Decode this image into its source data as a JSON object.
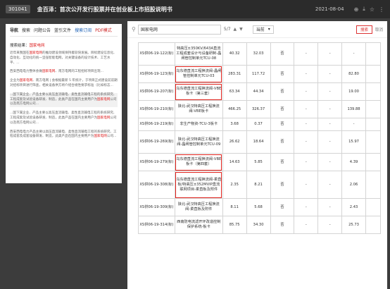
{
  "topbar": {
    "code": "301041",
    "title": "金百泽：首次公开发行股票并在创业板上市招股说明书",
    "date": "2021-08-04",
    "icons": [
      "globe-icon",
      "download-icon",
      "star-icon",
      "more-icon"
    ]
  },
  "left": {
    "tabs": [
      "导航",
      "搜索",
      "问题公告",
      "蓝引文件",
      "搜索订阅",
      "PDF模式"
    ],
    "search_prefix": "搜索结果：",
    "search_keyword": "国家电网",
    "results": [
      {
        "pre": "近年来我国在",
        "kw": "国家电网",
        "post": "的推动建设领域保持着较快发展。目标建设信息化、自动化、互动化的统一坚强智能电网，对关键设备的设计技术、工艺水平、..."
      },
      {
        "pre": "西安西电电力整体会做",
        "kw": "国家电网",
        "post": "、南方电网的工程招标项目出现..."
      },
      {
        "pre": "企业为",
        "kw": "国家电网",
        "post": "、南方电网 | 会根据最新 5 年统计，于项目正式建设前前期对招标项目进行筛查，相关设备供方将介绍合规性要求标准（比如标志..."
      },
      {
        "pre": "...国下属企业、产品主要以高压直流输电、柔性直流输电工程的系统研究、工程成套及试验设备研发、制造，此类产品在国内主要用户为",
        "kw": "国家电网",
        "post": "公司以及南方电网公司..."
      },
      {
        "pre": "...国下属企业、产品主要以高压直流输电、柔性直流输电工程的系统研究、工程成套及试验设备研发、制造，此类产品在国内主要用户为",
        "kw": "国家电网",
        "post": "公司以及南方电网公司..."
      },
      {
        "pre": "西安西电电力产品主要以高压直流输电、柔性直流输电工程的系统研究、工程成套及成套设备研发、制造，此类产品在国内主要用户为",
        "kw": "国家电网",
        "post": "公司..."
      }
    ]
  },
  "main": {
    "search_value": "国家电网",
    "page_current": "5",
    "page_total": "/7",
    "scope": "当前",
    "btn_search": "搜索",
    "btn_cancel": "取消"
  },
  "table_rows": [
    {
      "id": "XS供06-19-122(标)",
      "name": "特高压±350KV/643A直流工程成套设计与设备研制-晶闸管控制单元TCU-08",
      "q": "40.32",
      "a": "32.03",
      "yn": "否",
      "c1": "-",
      "c2": "-",
      "v": "-",
      "rows": 4
    },
    {
      "id": "XS供06-19-123(标)",
      "name": "乌东德直流工程换流阀-晶闸管控制单元TCU-03",
      "q": "283.31",
      "a": "117.72",
      "yn": "否",
      "c1": "-",
      "c2": "-",
      "v": "82.80",
      "rows": 3
    },
    {
      "id": "XS供06-19-207(标)",
      "name": "乌东德直流工程换流阀-VBE板卡（第三套）",
      "q": "63.34",
      "a": "44.34",
      "yn": "否",
      "c1": "-",
      "c2": "-",
      "v": "19.00",
      "rows": 3
    },
    {
      "id": "XS供06-19-210(标)",
      "name": "陕北-武汉特高压工程换流阀-VBE板卡",
      "q": "466.25",
      "a": "326.37",
      "yn": "否",
      "c1": "-",
      "c2": "-",
      "v": "139.88",
      "rows": 3
    },
    {
      "id": "XS供06-19-219(标)",
      "name": "非生产物资-TCU-3板卡",
      "q": "3.68",
      "a": "0.37",
      "yn": "否",
      "c1": "-",
      "c2": "-",
      "v": "-",
      "rows": 2
    },
    {
      "id": "XS供06-19-269(标)",
      "name": "陕北-武汉特高压工程换流阀-晶闸管控制单元TCU-09",
      "q": "26.62",
      "a": "18.64",
      "yn": "否",
      "c1": "-",
      "c2": "-",
      "v": "15.97",
      "rows": 4
    },
    {
      "id": "XS供06-19-279(标)",
      "name": "乌东德直流工程换流阀-VBE板卡（第四套）",
      "q": "14.63",
      "a": "5.85",
      "yn": "否",
      "c1": "-",
      "c2": "-",
      "v": "4.39",
      "rows": 3
    },
    {
      "id": "XS供06-19-308(标)",
      "name": "乌东德直流工程换流阀-柔直板/特高压±352MVIP直流联网项目-柔直板及附件",
      "q": "2.35",
      "a": "8.21",
      "yn": "否",
      "c1": "-",
      "c2": "-",
      "v": "2.06",
      "rows": 5
    },
    {
      "id": "XS供06-19-309(标)",
      "name": "陕北-武汉特高压工程换流阀-柔直板及附件",
      "q": "8.11",
      "a": "5.68",
      "yn": "否",
      "c1": "-",
      "c2": "-",
      "v": "2.43",
      "rows": 3
    },
    {
      "id": "XS供06-19-314(标)",
      "name": "西南防电流滤开环改造控制保护系统-板卡",
      "q": "85.75",
      "a": "34.30",
      "yn": "否",
      "c1": "-",
      "c2": "-",
      "v": "25.73",
      "rows": 3
    }
  ],
  "highlighted_rows": [
    1,
    2,
    6,
    7
  ],
  "colors": {
    "highlight": "#e0201a",
    "keyword": "#dd2222"
  }
}
